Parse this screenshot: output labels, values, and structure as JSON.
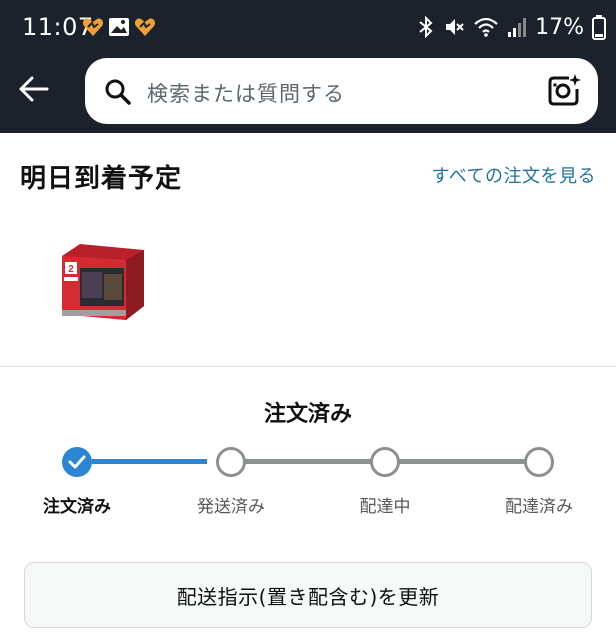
{
  "status_bar": {
    "time": "11:07",
    "battery": "17%"
  },
  "search": {
    "placeholder": "検索または質問する"
  },
  "delivery": {
    "title": "明日到着予定",
    "view_all_orders": "すべての注文を見る"
  },
  "product": {
    "box_label": "2"
  },
  "progress": {
    "current_status": "注文済み",
    "steps": [
      "注文済み",
      "発送済み",
      "配達中",
      "配達済み"
    ],
    "completed_steps": 1
  },
  "actions": {
    "update_delivery_button": "配送指示(置き配含む)を更新"
  },
  "colors": {
    "topbar": "#1b222b",
    "accent_blue": "#2a86d2",
    "link": "#227399",
    "notification_orange": "#f0a030"
  }
}
